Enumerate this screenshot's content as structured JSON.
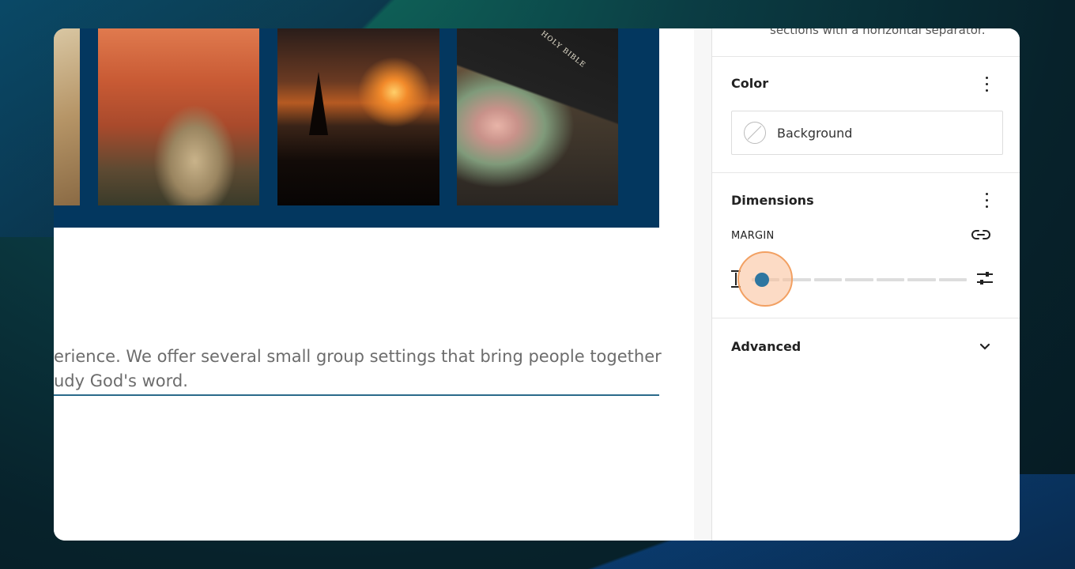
{
  "gallery": {
    "photos": [
      {
        "name": "wood-texture"
      },
      {
        "name": "canyon"
      },
      {
        "name": "sunset-mountains"
      },
      {
        "name": "bible-tulips",
        "book_label": "HOLY BIBLE"
      }
    ]
  },
  "paragraph": {
    "line1": "erience. We offer several small group settings that bring people together",
    "line2": "udy God's word."
  },
  "sidebar": {
    "top_text": "sections with a horizontal separator.",
    "color_panel": {
      "title": "Color",
      "background_label": "Background"
    },
    "dimensions_panel": {
      "title": "Dimensions",
      "margin_label": "MARGIN",
      "margin_value_fraction": 0.05
    },
    "advanced_panel": {
      "title": "Advanced"
    }
  },
  "colors": {
    "gallery_band": "#03375f",
    "slider_thumb": "#2e76a0",
    "highlight": "#f2a062",
    "underline": "#2a6a8a"
  }
}
